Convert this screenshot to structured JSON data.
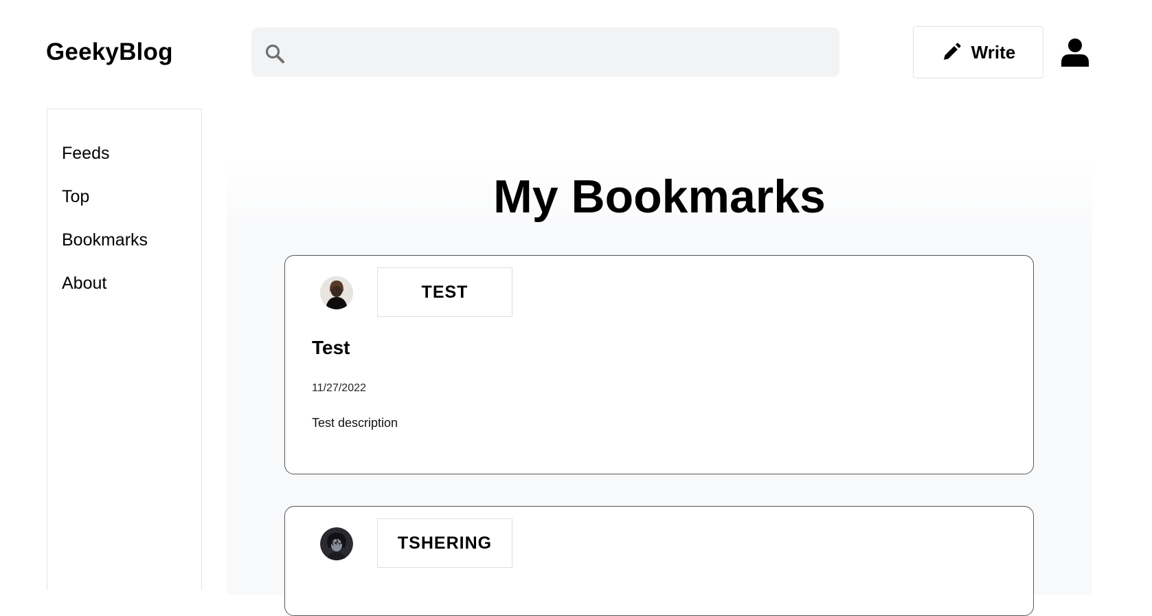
{
  "header": {
    "logo": "GeekyBlog",
    "search": {
      "value": "",
      "placeholder": "",
      "icon": "search-icon"
    },
    "write_label": "Write",
    "write_icon": "pencil-icon",
    "user_icon": "user-icon"
  },
  "sidebar": {
    "items": [
      {
        "label": "Feeds"
      },
      {
        "label": "Top"
      },
      {
        "label": "Bookmarks"
      },
      {
        "label": "About"
      }
    ]
  },
  "main": {
    "title": "My Bookmarks",
    "posts": [
      {
        "author": "TEST",
        "title": "Test",
        "date": "11/27/2022",
        "description": "Test description"
      },
      {
        "author": "TSHERING"
      }
    ]
  },
  "colors": {
    "search_bg": "#f2f3f5",
    "border": "#e4e4e4",
    "card_border": "#555555",
    "main_bg": "#f8f9fb"
  }
}
